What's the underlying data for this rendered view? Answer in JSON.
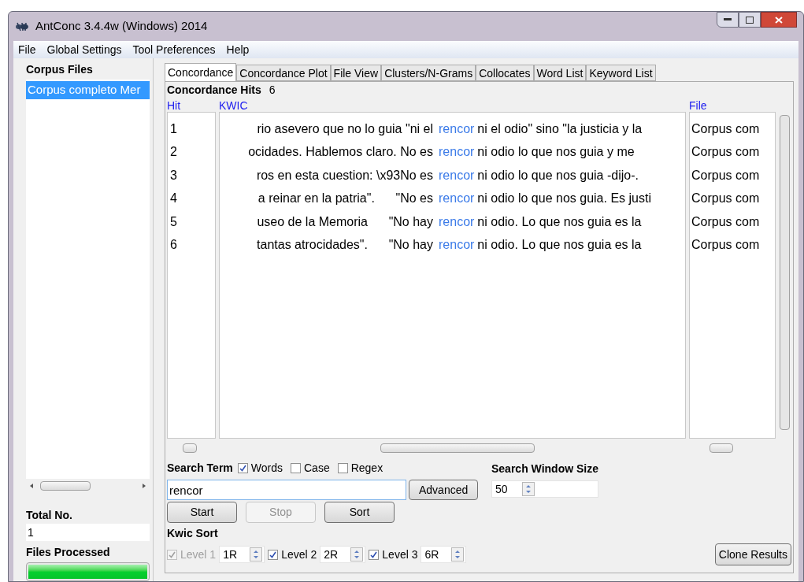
{
  "window": {
    "title": "AntConc 3.4.4w (Windows) 2014"
  },
  "menu": [
    "File",
    "Global Settings",
    "Tool Preferences",
    "Help"
  ],
  "corpus_files": {
    "heading": "Corpus Files",
    "items": [
      {
        "name": "Corpus completo Mer",
        "selected": true
      }
    ]
  },
  "total": {
    "label": "Total No.",
    "value": "1"
  },
  "files_processed": {
    "label": "Files Processed",
    "level": 1
  },
  "tabs": [
    {
      "label": "Concordance",
      "selected": true
    },
    {
      "label": "Concordance Plot",
      "selected": false
    },
    {
      "label": "File View",
      "selected": false
    },
    {
      "label": "Clusters/N-Grams",
      "selected": false
    },
    {
      "label": "Collocates",
      "selected": false
    },
    {
      "label": "Word List",
      "selected": false
    },
    {
      "label": "Keyword List",
      "selected": false
    }
  ],
  "hits": {
    "label": "Concordance Hits",
    "value": "6"
  },
  "table": {
    "columns": [
      "Hit",
      "KWIC",
      "File"
    ],
    "rows": [
      {
        "hit": "1",
        "left": "rio asevero que no lo guia \"ni el",
        "keyword": "rencor",
        "right": "ni el odio\" sino \"la justicia y la",
        "file": "Corpus com"
      },
      {
        "hit": "2",
        "left": "ocidades. Hablemos claro. No es",
        "keyword": "rencor",
        "right": "ni odio lo que nos guia y me",
        "file": "Corpus com"
      },
      {
        "hit": "3",
        "left": "ros en esta cuestion: \\x93No es",
        "keyword": "rencor",
        "right": "ni odio lo que nos guia -dijo-.",
        "file": "Corpus com"
      },
      {
        "hit": "4",
        "left": "a reinar en la patria\".      \"No es",
        "keyword": "rencor",
        "right": "ni odio lo que nos guia. Es justi",
        "file": "Corpus com"
      },
      {
        "hit": "5",
        "left": "useo de la Memoria      \"No hay",
        "keyword": "rencor",
        "right": "ni odio. Lo que nos guia es la",
        "file": "Corpus com"
      },
      {
        "hit": "6",
        "left": "tantas atrocidades\".      \"No hay",
        "keyword": "rencor",
        "right": "ni odio. Lo que nos guia es la",
        "file": "Corpus com"
      }
    ]
  },
  "search": {
    "label": "Search Term",
    "options": [
      {
        "label": "Words",
        "checked": true
      },
      {
        "label": "Case",
        "checked": false
      },
      {
        "label": "Regex",
        "checked": false
      }
    ],
    "value": "rencor",
    "advanced": "Advanced"
  },
  "window_size": {
    "label": "Search Window Size",
    "value": "50"
  },
  "buttons": [
    {
      "label": "Start",
      "disabled": false
    },
    {
      "label": "Stop",
      "disabled": true
    },
    {
      "label": "Sort",
      "disabled": false
    }
  ],
  "kwic_sort": {
    "label": "Kwic Sort",
    "levels": [
      {
        "label": "Level 1",
        "checked": true,
        "disabled": true,
        "value": "1R"
      },
      {
        "label": "Level 2",
        "checked": true,
        "disabled": false,
        "value": "2R"
      },
      {
        "label": "Level 3",
        "checked": true,
        "disabled": false,
        "value": "6R"
      }
    ]
  },
  "clone": "Clone Results"
}
